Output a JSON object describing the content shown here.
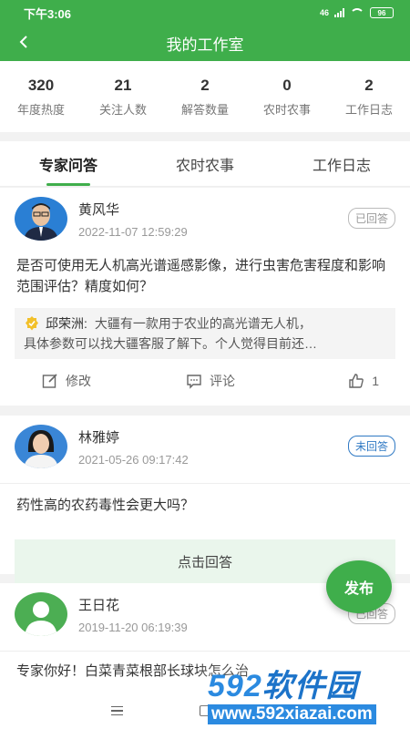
{
  "status_bar": {
    "time": "下午3:06",
    "network": "46",
    "battery": "96"
  },
  "header": {
    "title": "我的工作室"
  },
  "stats": [
    {
      "value": "320",
      "label": "年度热度"
    },
    {
      "value": "21",
      "label": "关注人数"
    },
    {
      "value": "2",
      "label": "解答数量"
    },
    {
      "value": "0",
      "label": "农时农事"
    },
    {
      "value": "2",
      "label": "工作日志"
    }
  ],
  "tabs": [
    {
      "label": "专家问答",
      "active": true
    },
    {
      "label": "农时农事",
      "active": false
    },
    {
      "label": "工作日志",
      "active": false
    }
  ],
  "posts": [
    {
      "name": "黄风华",
      "time": "2022-11-07 12:59:29",
      "status": "已回答",
      "question": "是否可使用无人机高光谱遥感影像，进行虫害危害程度和影响范围评估？精度如何？",
      "answer": {
        "expert": "邱荣洲:",
        "line1": "大疆有一款用于农业的高光谱无人机，",
        "line2": "具体参数可以找大疆客服了解下。个人觉得目前还…"
      },
      "actions": {
        "edit": "修改",
        "comment": "评论",
        "likes": "1"
      }
    },
    {
      "name": "林雅婷",
      "time": "2021-05-26 09:17:42",
      "status": "未回答",
      "question": "药性高的农药毒性会更大吗？",
      "answer_button": "点击回答"
    },
    {
      "name": "王日花",
      "time": "2019-11-20 06:19:39",
      "status": "已回答",
      "question": "专家你好！白菜青菜根部长球块怎么治"
    }
  ],
  "fab": {
    "label": "发布"
  },
  "watermark": {
    "logo_num": "592",
    "logo_cn": "软件园",
    "url": "www.592xiazai.com"
  },
  "colors": {
    "brand_green": "#3fae4b",
    "badge_blue": "#2f79c4",
    "answer_bg": "#eaf6ec"
  }
}
